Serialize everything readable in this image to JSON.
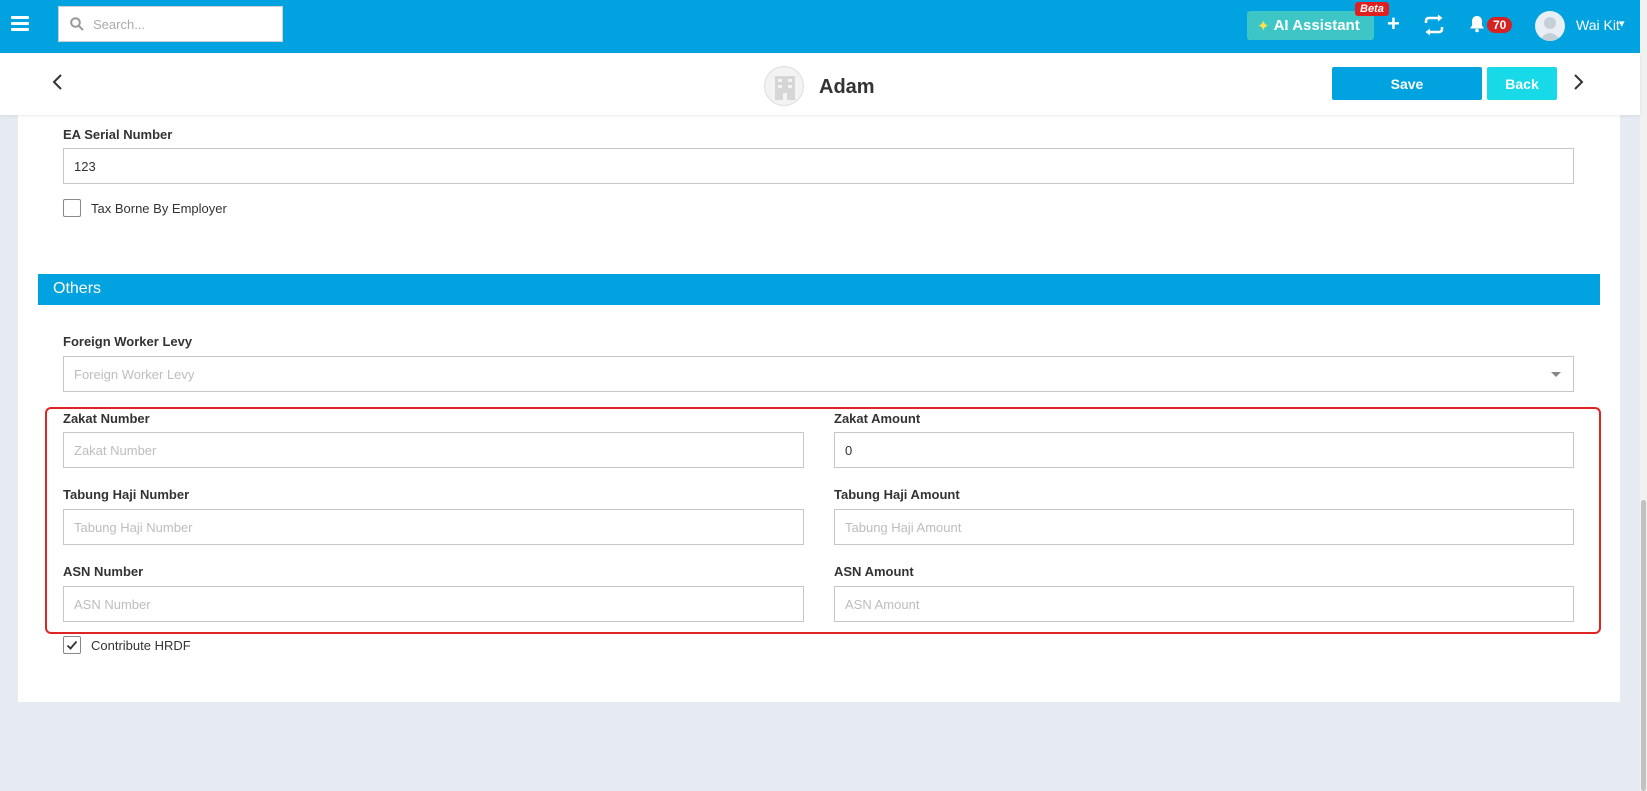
{
  "topbar": {
    "search_placeholder": "Search...",
    "ai_label": "AI Assistant",
    "beta_label": "Beta",
    "notification_count": "70",
    "user_name": "Wai Kit"
  },
  "header": {
    "employee_name": "Adam",
    "save_label": "Save",
    "back_label": "Back"
  },
  "form": {
    "ea_serial": {
      "label": "EA Serial Number",
      "value": "123"
    },
    "tax_borne": {
      "label": "Tax Borne By Employer",
      "checked": false
    },
    "others_section": "Others",
    "foreign_worker_levy": {
      "label": "Foreign Worker Levy",
      "placeholder": "Foreign Worker Levy"
    },
    "zakat_number": {
      "label": "Zakat Number",
      "placeholder": "Zakat Number"
    },
    "zakat_amount": {
      "label": "Zakat Amount",
      "value": "0"
    },
    "tabung_haji_number": {
      "label": "Tabung Haji Number",
      "placeholder": "Tabung Haji Number"
    },
    "tabung_haji_amount": {
      "label": "Tabung Haji Amount",
      "placeholder": "Tabung Haji Amount"
    },
    "asn_number": {
      "label": "ASN Number",
      "placeholder": "ASN Number"
    },
    "asn_amount": {
      "label": "ASN Amount",
      "placeholder": "ASN Amount"
    },
    "contribute_hrdf": {
      "label": "Contribute HRDF",
      "checked": true
    }
  },
  "colors": {
    "brand": "#00a3e0",
    "back_button": "#17d9e8",
    "ai_button": "#3ec6c7",
    "highlight": "#e02424",
    "badge": "#d62222"
  },
  "icons": [
    "hamburger-icon",
    "search-icon",
    "sparkle-icon",
    "plus-icon",
    "sync-icon",
    "bell-icon",
    "user-avatar",
    "chevron-left-icon",
    "chevron-right-icon",
    "chevron-down-icon",
    "checkmark-icon"
  ]
}
